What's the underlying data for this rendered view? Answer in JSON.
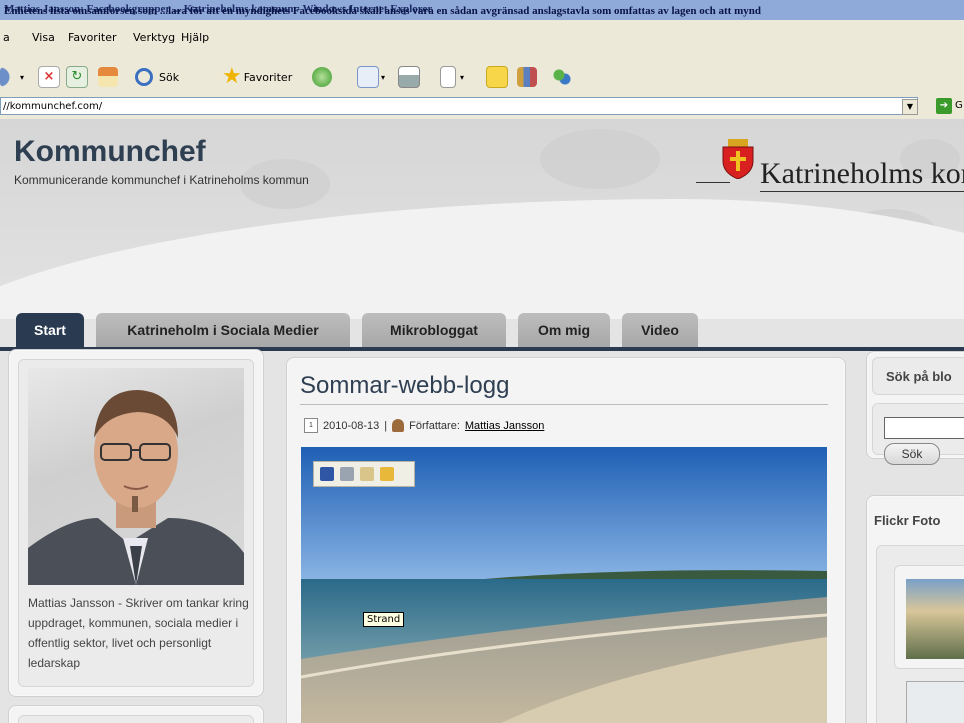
{
  "window": {
    "title": "Mattias Jansson: Facebookgrupper ... Katrineholms kommun - Windows Internet Explorer",
    "tooltip_overlay": "Enhetens lista omsamforsen som ...lara för att en myndighets Facebooksida skall anses vara en sådan avgränsad anslagstavla som omfattas av lagen och att mynd"
  },
  "menu": {
    "items": [
      "a",
      "Visa",
      "Favoriter",
      "Verktyg",
      "Hjälp"
    ]
  },
  "toolbar": {
    "search_label": "Sök",
    "favorites_label": "Favoriter"
  },
  "address": {
    "url": "//kommunchef.com/",
    "go_label": "G"
  },
  "site": {
    "title": "Kommunchef",
    "subtitle": "Kommunicerande kommunchef i Katrineholms kommun",
    "municipality": "Katrineholms kom"
  },
  "nav": {
    "tabs": [
      "Start",
      "Katrineholm i Sociala Medier",
      "Mikrobloggat",
      "Om mig",
      "Video"
    ]
  },
  "sidebar_left": {
    "bio": "Mattias Jansson - Skriver om tankar kring uppdraget, kommunen, sociala medier i offentlig sektor, livet och personligt ledarskap"
  },
  "post": {
    "title": "Sommar-webb-logg",
    "date": "2010-08-13",
    "separator": " | ",
    "author_prefix": "Författare:",
    "author": "Mattias Jansson",
    "image_tooltip": "Strand"
  },
  "sidebar_right": {
    "search_heading": "Sök på blo",
    "search_button": "Sök",
    "flickr_heading": "Flickr Foto"
  },
  "colors": {
    "nav_dark": "#2a3a50",
    "title_blue": "#2f3f52",
    "tab_grey": "#b3b3b3"
  }
}
